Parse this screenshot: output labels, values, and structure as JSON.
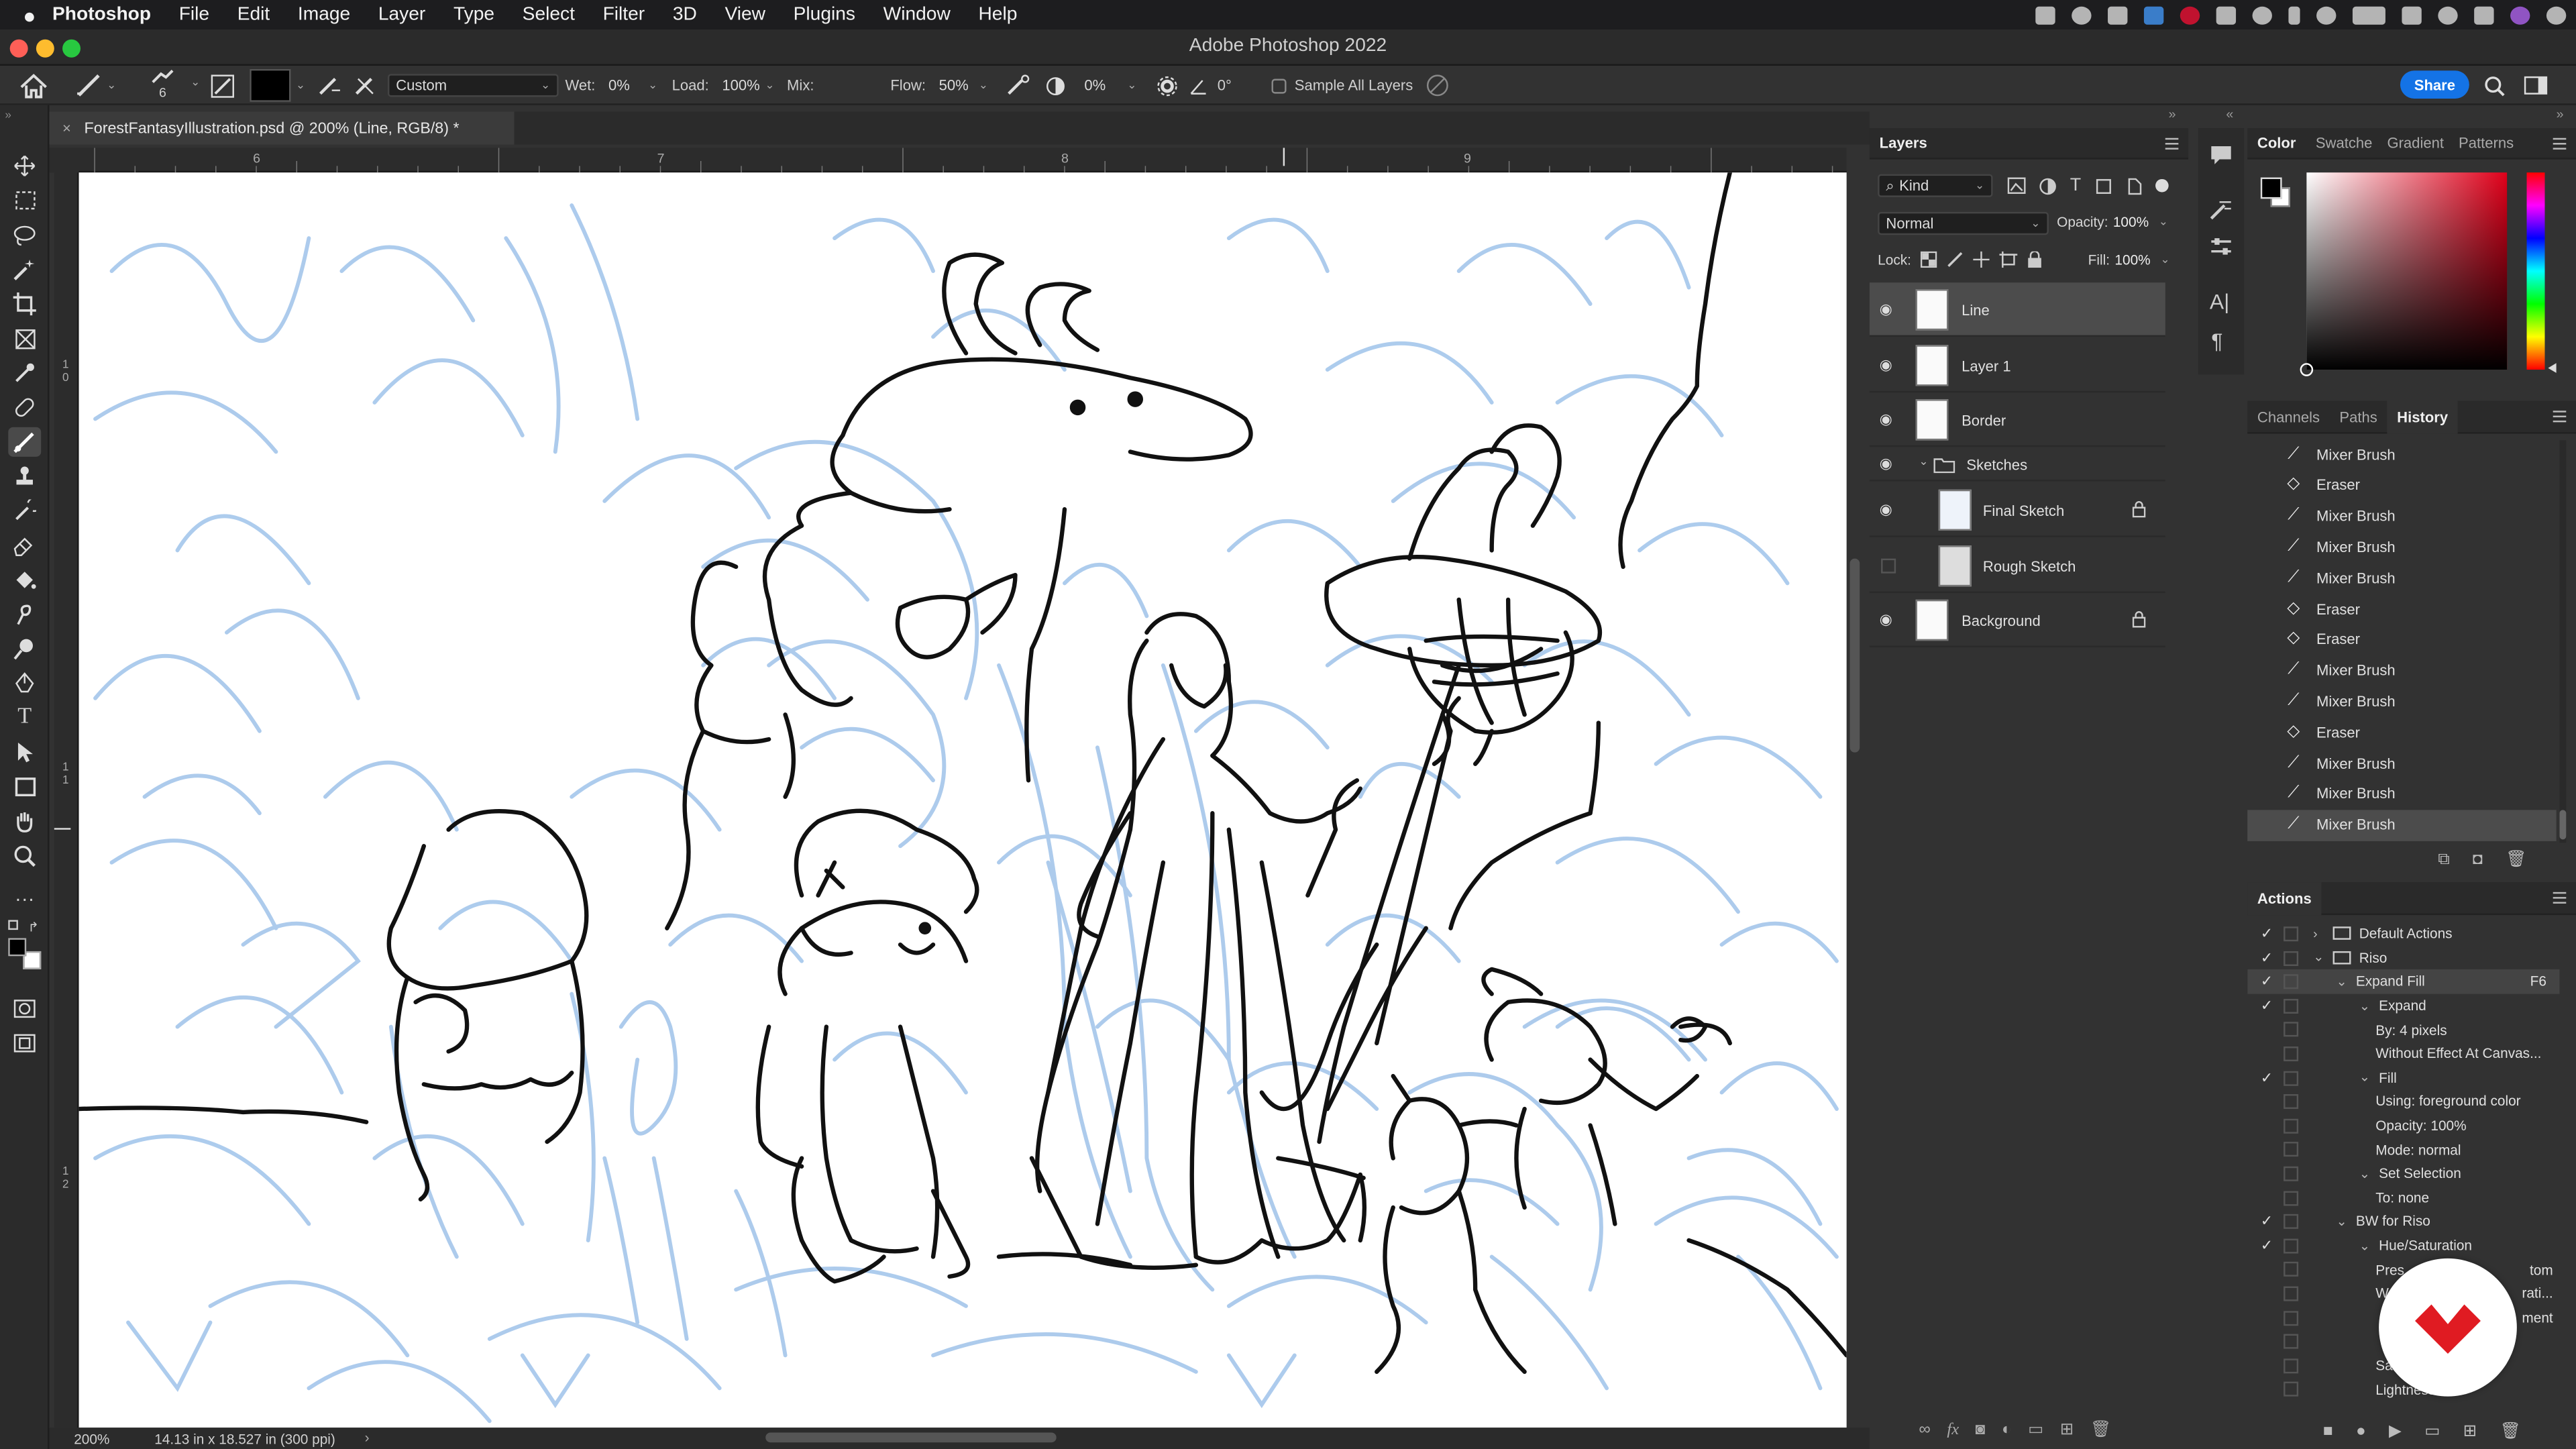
{
  "menubar": {
    "apple": "",
    "app": "Photoshop",
    "items": [
      "File",
      "Edit",
      "Image",
      "Layer",
      "Type",
      "Select",
      "Filter",
      "3D",
      "View",
      "Plugins",
      "Window",
      "Help"
    ]
  },
  "titlebar": {
    "title": "Adobe Photoshop 2022"
  },
  "options": {
    "brush_size": "6",
    "preset": "Custom",
    "wet_label": "Wet:",
    "wet": "0%",
    "load_label": "Load:",
    "load": "100%",
    "mix_label": "Mix:",
    "mix": "",
    "flow_label": "Flow:",
    "flow": "50%",
    "smoothing": "0%",
    "angle": "0°",
    "sample_all_layers": "Sample All Layers",
    "share": "Share"
  },
  "document": {
    "tab_title": "ForestFantasyIllustration.psd @ 200% (Line, RGB/8) *",
    "ruler_h": [
      "6",
      "7",
      "8",
      "9"
    ],
    "ruler_v": [
      "1",
      "0",
      "1",
      "1",
      "1",
      "2"
    ],
    "zoom": "200%",
    "doc_size": "14.13 in x 18.527 in (300 ppi)"
  },
  "layers_panel": {
    "tab": "Layers",
    "filter_kind": "Kind",
    "blend_mode": "Normal",
    "opacity_label": "Opacity:",
    "opacity": "100%",
    "lock_label": "Lock:",
    "fill_label": "Fill:",
    "fill": "100%",
    "layers": [
      {
        "name": "Line",
        "visible": true,
        "selected": true
      },
      {
        "name": "Layer 1",
        "visible": true
      },
      {
        "name": "Border",
        "visible": true
      },
      {
        "name": "Sketches",
        "visible": true,
        "group": true
      },
      {
        "name": "Final Sketch",
        "visible": true,
        "locked": true,
        "indent": true
      },
      {
        "name": "Rough Sketch",
        "visible": false,
        "indent": true
      },
      {
        "name": "Background",
        "visible": true,
        "locked": true
      }
    ]
  },
  "color_panel": {
    "tabs": [
      "Color",
      "Swatche",
      "Gradient",
      "Patterns"
    ],
    "foreground": "#000000",
    "background": "#ffffff",
    "hue": "#e0001a"
  },
  "history_panel": {
    "tabs": [
      "Channels",
      "Paths",
      "History"
    ],
    "items": [
      "Mixer Brush",
      "Eraser",
      "Mixer Brush",
      "Mixer Brush",
      "Mixer Brush",
      "Eraser",
      "Eraser",
      "Mixer Brush",
      "Mixer Brush",
      "Eraser",
      "Mixer Brush",
      "Mixer Brush",
      "Mixer Brush"
    ]
  },
  "actions_panel": {
    "tab": "Actions",
    "rows": [
      {
        "text": "Default Actions",
        "level": 0,
        "folder": true,
        "check": "✓"
      },
      {
        "text": "Riso",
        "level": 0,
        "folder": true,
        "check": "✓"
      },
      {
        "text": "Expand Fill",
        "level": 1,
        "shortcut": "F6",
        "check": "✓"
      },
      {
        "text": "Expand",
        "level": 2,
        "check": "✓"
      },
      {
        "text": "By: 4 pixels",
        "level": 3
      },
      {
        "text": "Without Effect At Canvas...",
        "level": 3
      },
      {
        "text": "Fill",
        "level": 2,
        "check": "✓"
      },
      {
        "text": "Using: foreground color",
        "level": 3
      },
      {
        "text": "Opacity: 100%",
        "level": 3
      },
      {
        "text": "Mode: normal",
        "level": 3
      },
      {
        "text": "Set Selection",
        "level": 2
      },
      {
        "text": "To: none",
        "level": 3
      },
      {
        "text": "BW for Riso",
        "level": 1,
        "check": "✓"
      },
      {
        "text": "Hue/Saturation",
        "level": 2,
        "check": "✓"
      },
      {
        "text": "Pres",
        "tail": "tom",
        "level": 3
      },
      {
        "text": "W",
        "tail": "rati...",
        "level": 3
      },
      {
        "text": "",
        "tail": "ment",
        "level": 3
      },
      {
        "text": "",
        "level": 3
      },
      {
        "text": "Sa",
        "level": 3
      },
      {
        "text": "Lightness: 100",
        "level": 3
      }
    ]
  },
  "badge": {
    "color": "#e01b22"
  }
}
